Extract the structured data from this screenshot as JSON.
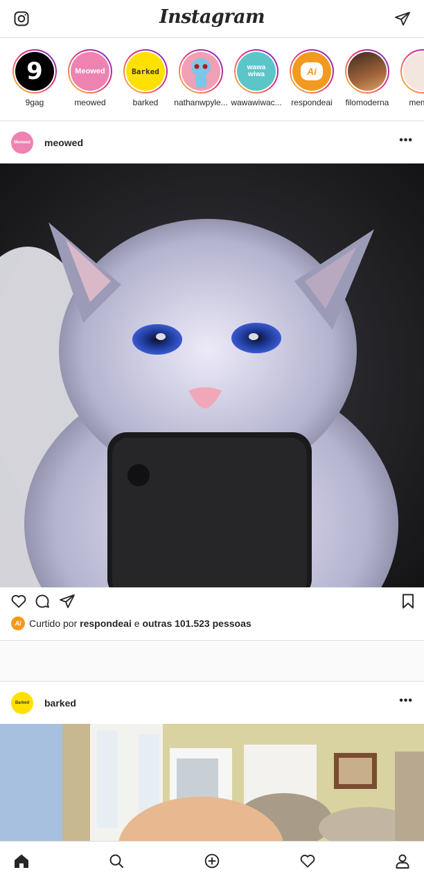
{
  "app": {
    "logo_text": "Instagram"
  },
  "header": {
    "left_icon": "instagram-camera-icon",
    "right_icon": "direct-message-icon"
  },
  "stories": [
    {
      "name": "9gag",
      "avatar_text": "9",
      "bg": "#000000",
      "fg": "#ffffff"
    },
    {
      "name": "meowed",
      "avatar_text": "Meowed",
      "bg": "#ee82b0",
      "fg": "#ffffff"
    },
    {
      "name": "barked",
      "avatar_text": "Barked",
      "bg": "#ffe100",
      "fg": "#333333"
    },
    {
      "name": "nathanwpyle...",
      "avatar_text": "",
      "bg": "#f0a0b4",
      "fg": "#5ab0d8"
    },
    {
      "name": "wawawiwac...",
      "avatar_text": "wawa wiwa",
      "bg": "#5bc5c8",
      "fg": "#ffffff"
    },
    {
      "name": "respondeai",
      "avatar_text": "Ai",
      "bg": "#f29a1f",
      "fg": "#ffffff"
    },
    {
      "name": "filomoderna",
      "avatar_text": "",
      "bg": "#7a4a2a",
      "fg": "#ffffff"
    },
    {
      "name": "memes",
      "avatar_text": "",
      "bg": "#f3e6df",
      "fg": "#c0392b"
    }
  ],
  "posts": [
    {
      "username": "meowed",
      "avatar_text": "Meowed",
      "avatar_bg": "#ee82b0",
      "more_label": "•••",
      "liked_by_prefix": "Curtido por",
      "liked_by_user": "respondeai",
      "liked_by_joiner": "e",
      "liked_by_others": "outras 101.523 pessoas"
    },
    {
      "username": "barked",
      "avatar_text": "Barked",
      "avatar_bg": "#ffe100",
      "more_label": "•••"
    }
  ],
  "post_actions": [
    "heart-icon",
    "comment-icon",
    "share-icon",
    "bookmark-icon"
  ],
  "bottom_nav": [
    "home-icon",
    "search-icon",
    "new-post-icon",
    "activity-heart-icon",
    "profile-icon"
  ]
}
